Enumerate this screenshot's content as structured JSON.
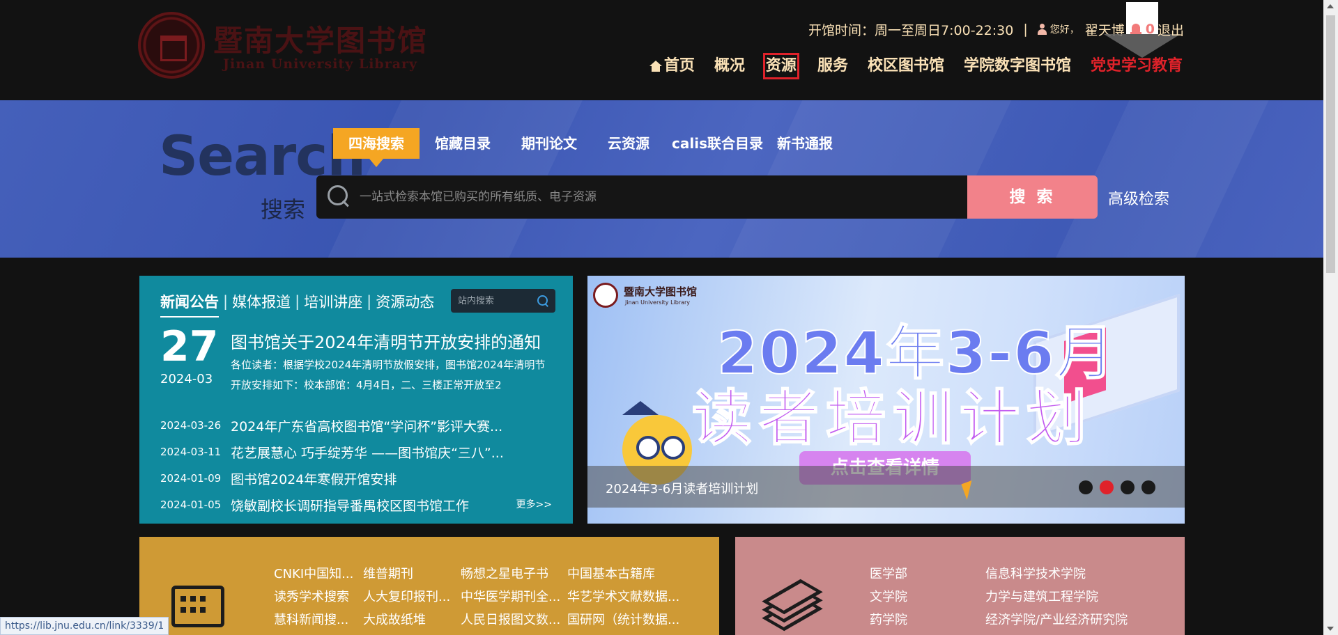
{
  "header": {
    "logo_cn": "暨南大学图书馆",
    "logo_en": "Jinan University Library",
    "hours_label": "开馆时间：周一至周日7:00-22:30",
    "separator": "|",
    "greeting": "您好，",
    "username": "翟天博",
    "notification_count": "0",
    "logout": "退出",
    "nav": [
      {
        "label": "首页",
        "icon": "home-icon"
      },
      {
        "label": "概况"
      },
      {
        "label": "资源",
        "state": "active"
      },
      {
        "label": "服务"
      },
      {
        "label": "校区图书馆"
      },
      {
        "label": "学院数字图书馆"
      },
      {
        "label": "党史学习教育",
        "state": "highlight"
      }
    ]
  },
  "search": {
    "word_en": "Search",
    "word_cn": "搜索",
    "tabs": [
      "四海搜索",
      "馆藏目录",
      "期刊论文",
      "云资源",
      "calis联合目录",
      "新书通报"
    ],
    "active_tab": "四海搜索",
    "placeholder": "一站式检索本馆已购买的所有纸质、电子资源",
    "button": "搜 索",
    "advanced": "高级检索"
  },
  "news": {
    "tabs": [
      "新闻公告",
      "媒体报道",
      "培训讲座",
      "资源动态"
    ],
    "active_tab": "新闻公告",
    "site_search_placeholder": "站内搜索",
    "featured": {
      "day": "27",
      "year_month": "2024-03",
      "title": "图书馆关于2024年清明节开放安排的通知",
      "desc": "各位读者：根据学校2024年清明节放假安排，图书馆2024年清明节开放安排如下：校本部馆：4月4日，二、三楼正常开放至2"
    },
    "items": [
      {
        "date": "2024-03-26",
        "title": "2024年广东省高校图书馆“学问杯”影评大赛..."
      },
      {
        "date": "2024-03-11",
        "title": "花艺展慧心 巧手绽芳华 ——图书馆庆“三八”..."
      },
      {
        "date": "2024-01-09",
        "title": "图书馆2024年寒假开馆安排"
      },
      {
        "date": "2024-01-05",
        "title": "饶敏副校长调研指导番禺校区图书馆工作"
      }
    ],
    "more": "更多>>"
  },
  "banner": {
    "logo_cn": "暨南大学图书馆",
    "logo_en": "Jinan University Library",
    "headline": "2024年3-6月",
    "subheadline": "读者培训计划",
    "cta": "点击查看详情",
    "caption": "2024年3-6月读者培训计划",
    "slide_count": 4,
    "active_slide": 2
  },
  "databases": {
    "icon": "database-grid-icon",
    "links": [
      "CNKI中国知...",
      "维普期刊",
      "畅想之星电子书",
      "中国基本古籍库",
      "读秀学术搜索",
      "人大复印报刊...",
      "中华医学期刊全...",
      "华艺学术文献数据...",
      "慧科新闻搜...",
      "大成故纸堆",
      "人民日报图文数...",
      "国研网（统计数据..."
    ]
  },
  "colleges": {
    "icon": "layers-icon",
    "links": [
      "医学部",
      "信息科学技术学院",
      "文学院",
      "力学与建筑工程学院",
      "药学院",
      "经济学院/产业经济研究院"
    ]
  },
  "status_bar": {
    "url": "https://lib.jnu.edu.cn/link/3339/1"
  },
  "colors": {
    "header_bg": "#121212",
    "nav_text": "#fae1b6",
    "nav_highlight": "#e0222a",
    "search_band": "#4560ba",
    "active_tab": "#f5a623",
    "search_button": "#f2828a",
    "news_panel": "#108a9e",
    "db_card": "#cf9a35",
    "college_card": "#c98a8b"
  }
}
